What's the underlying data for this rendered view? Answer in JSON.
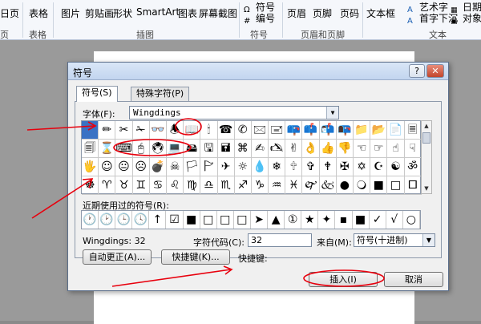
{
  "ribbon": {
    "left_partial": "日页",
    "left_partial_label": "页",
    "table": "表格",
    "table_label": "表格",
    "picture": "图片",
    "clipart": "剪贴画",
    "shapes": "形状",
    "smartart": "SmartArt",
    "chart": "图表",
    "screenshot": "屏幕截图",
    "illustration_label": "插图",
    "symbol": "符号",
    "number": "编号",
    "symbol_label": "符号",
    "header": "页眉",
    "footer": "页脚",
    "pagenum": "页码",
    "header_footer_label": "页眉和页脚",
    "textbox": "文本框",
    "wordart": "艺术字",
    "dropcap": "首字下沉",
    "datetime": "日期和",
    "object": "对象",
    "text_label": "文本"
  },
  "dialog": {
    "title": "符号",
    "help": "?",
    "close": "✕",
    "tabs": [
      "符号(S)",
      "特殊字符(P)"
    ],
    "font_label": "字体(F):",
    "font_value": "Wingdings",
    "symbol_rows": [
      [
        "",
        "✏",
        "✂",
        "✁",
        "👓",
        "🕭",
        "📖",
        "🕯",
        "☎",
        "✆",
        "🖂",
        "🖃",
        "📪",
        "📫",
        "📬",
        "📭",
        "📁",
        "📂",
        "📄",
        "🗏"
      ],
      [
        "🗐",
        "⌛",
        "⌨",
        "🖰",
        "🖲",
        "💻",
        "🖴",
        "🖫",
        "🖬",
        "⌘",
        "✍",
        "🖎",
        "✌",
        "👌",
        "👍",
        "👎",
        "☜",
        "☞",
        "☝",
        "☟"
      ],
      [
        "🖐",
        "☺",
        "😐",
        "☹",
        "💣",
        "☠",
        "🏳",
        "🏱",
        "✈",
        "☼",
        "💧",
        "❄",
        "🕆",
        "✞",
        "🕈",
        "✠",
        "✡",
        "☪",
        "☯",
        "ॐ"
      ],
      [
        "☸",
        "♈",
        "♉",
        "♊",
        "♋",
        "♌",
        "♍",
        "♎",
        "♏",
        "♐",
        "♑",
        "♒",
        "♓",
        "🙰",
        "🙵",
        "●",
        "🔾",
        "■",
        "□",
        "🞐"
      ]
    ],
    "recent_label": "近期使用过的符号(R):",
    "recent_symbols": [
      "🕐",
      "🕑",
      "🕒",
      "🕓",
      "↑",
      "☑",
      "■",
      "□",
      "□",
      "□",
      "➤",
      "▲",
      "①",
      "★",
      "✦",
      "▪",
      "■",
      "✓",
      "√",
      "○"
    ],
    "info_text": "Wingdings: 32",
    "char_code_label": "字符代码(C):",
    "char_code_value": "32",
    "from_label": "来自(M):",
    "from_value": "符号(十进制)",
    "autocorrect_button": "自动更正(A)...",
    "shortcut_key_button": "快捷键(K)...",
    "shortcut_label": "快捷键:",
    "insert_button": "插入(I)",
    "cancel_button": "取消"
  },
  "colors": {
    "annotation": "#e8000d",
    "selection": "#3a72c4"
  }
}
